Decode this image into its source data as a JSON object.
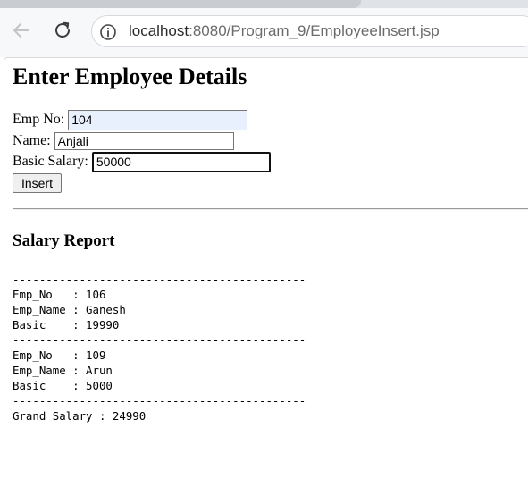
{
  "browser": {
    "url_host": "localhost",
    "url_rest": ":8080/Program_9/EmployeeInsert.jsp",
    "icons": {
      "back": "back-arrow-icon",
      "reload": "reload-icon",
      "site_info": "info-icon"
    }
  },
  "page": {
    "title": "Enter Employee Details",
    "form": {
      "empno_label": "Emp No:",
      "empno_value": "104",
      "name_label": "Name:",
      "name_value": "Anjali",
      "salary_label": "Basic Salary:",
      "salary_value": "50000",
      "submit_label": "Insert"
    },
    "report": {
      "title": "Salary Report",
      "separator": "--------------------------------------------",
      "employees": [
        {
          "empno_line": "Emp_No   : 106",
          "name_line": "Emp_Name : Ganesh",
          "basic_line": "Basic    : 19990"
        },
        {
          "empno_line": "Emp_No   : 109",
          "name_line": "Emp_Name : Arun",
          "basic_line": "Basic    : 5000"
        }
      ],
      "grand_total_line": "Grand Salary : 24990"
    }
  }
}
